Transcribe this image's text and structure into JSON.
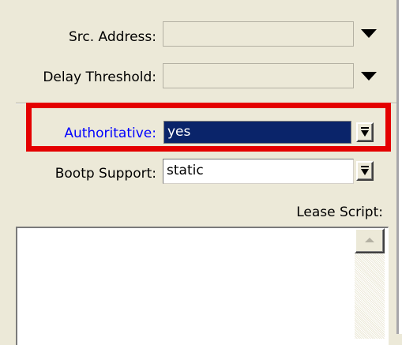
{
  "form": {
    "src_address": {
      "label": "Src. Address:",
      "value": ""
    },
    "delay_threshold": {
      "label": "Delay Threshold:",
      "value": ""
    },
    "authoritative": {
      "label": "Authoritative:",
      "value": "yes"
    },
    "bootp_support": {
      "label": "Bootp Support:",
      "value": "static"
    },
    "lease_script": {
      "label": "Lease Script:",
      "value": ""
    }
  },
  "colors": {
    "highlight_border": "#e40000",
    "selected_label": "#0000ff",
    "selected_value_bg": "#0a246a"
  },
  "icons": {
    "dropdown_arrow": "triangle-down",
    "combo_button": "dropdown-combo",
    "scroll_up": "arrow-up"
  }
}
